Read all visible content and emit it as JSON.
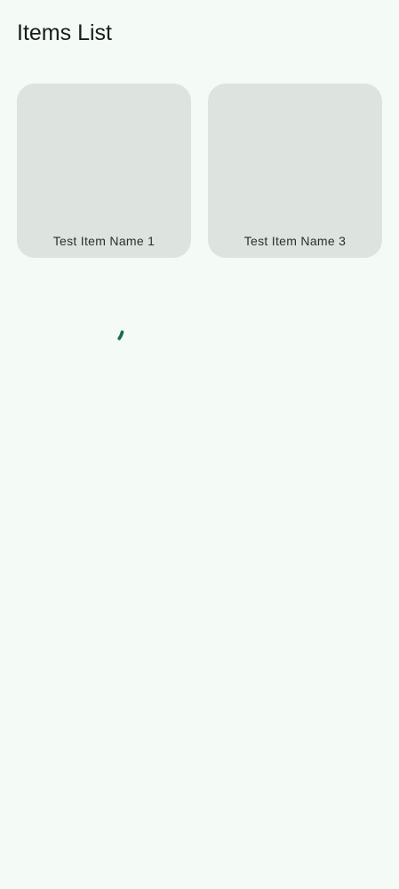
{
  "app": {
    "title": "Items List"
  },
  "items": [
    {
      "name": "Test Item Name 1"
    },
    {
      "name": "Test Item Name 3"
    }
  ],
  "loading": {
    "visible": true,
    "indicator": "circular-progress-icon"
  },
  "colors": {
    "background": "#f4faf6",
    "card": "#dde3df",
    "text": "#191c1b",
    "accent": "#1b6b4f"
  }
}
